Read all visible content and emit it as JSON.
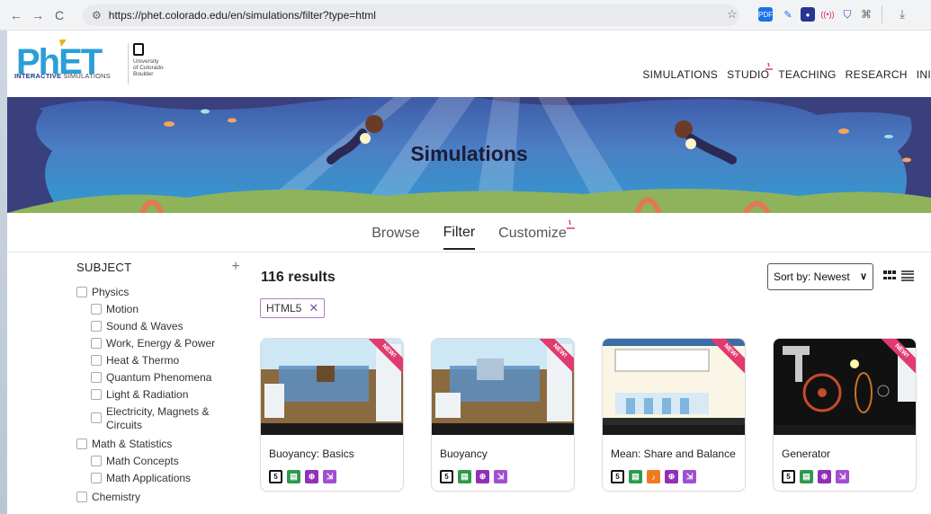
{
  "browser": {
    "url": "https://phet.colorado.edu/en/simulations/filter?type=html",
    "back": "←",
    "forward": "→",
    "reload": "C"
  },
  "header": {
    "logo_text": "PhET",
    "logo_tagline_bold": "INTERACTIVE",
    "logo_tagline": " SIMULATIONS",
    "university": "University\nof Colorado\nBoulder",
    "nav": [
      "SIMULATIONS",
      "STUDIO",
      "TEACHING",
      "RESEARCH",
      "INI"
    ]
  },
  "banner": {
    "title": "Simulations"
  },
  "tabs": [
    {
      "label": "Browse",
      "active": false
    },
    {
      "label": "Filter",
      "active": true
    },
    {
      "label": "Customize",
      "active": false
    }
  ],
  "sidebar": {
    "title": "SUBJECT",
    "groups": [
      {
        "label": "Physics",
        "items": [
          "Motion",
          "Sound & Waves",
          "Work, Energy & Power",
          "Heat & Thermo",
          "Quantum Phenomena",
          "Light & Radiation",
          "Electricity, Magnets & Circuits"
        ]
      },
      {
        "label": "Math & Statistics",
        "items": [
          "Math Concepts",
          "Math Applications"
        ]
      },
      {
        "label": "Chemistry",
        "items": []
      }
    ]
  },
  "results": {
    "count": "116 results",
    "sort_label": "Sort by: Newest",
    "filter_chip": "HTML5"
  },
  "cards": [
    {
      "title": "Buoyancy: Basics",
      "new": true,
      "badges": [
        "html5",
        "green",
        "purple",
        "purple2"
      ]
    },
    {
      "title": "Buoyancy",
      "new": true,
      "badges": [
        "html5",
        "green",
        "purple",
        "purple2"
      ]
    },
    {
      "title": "Mean: Share and Balance",
      "new": true,
      "badges": [
        "html5",
        "green",
        "orange",
        "purple",
        "purple2"
      ]
    },
    {
      "title": "Generator",
      "new": true,
      "badges": [
        "html5",
        "green",
        "purple",
        "purple2"
      ]
    }
  ],
  "new_label": "NEW!",
  "colors": {
    "accent_pink": "#e03a6e",
    "chip_border": "#b07cc6",
    "badge_green": "#2e9a4b",
    "badge_purple": "#9230b5",
    "badge_orange": "#f07a24"
  }
}
